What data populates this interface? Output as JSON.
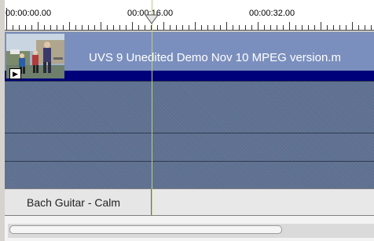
{
  "ruler": {
    "labels": [
      "00:00:00.00",
      "00:00:16.00",
      "00:00:32.00"
    ]
  },
  "video_track": {
    "clip_title": "UVS 9 Unedited Demo Nov 10 MPEG version.m",
    "speaker_icon": "speaker-icon"
  },
  "audio_track": {
    "clip_label": "Bach Guitar - Calm"
  },
  "colors": {
    "track_bg": "#5c6e8f",
    "clip_bg": "#7b8fbe",
    "clip_band": "#00007a",
    "playhead": "#b6cf8a"
  }
}
